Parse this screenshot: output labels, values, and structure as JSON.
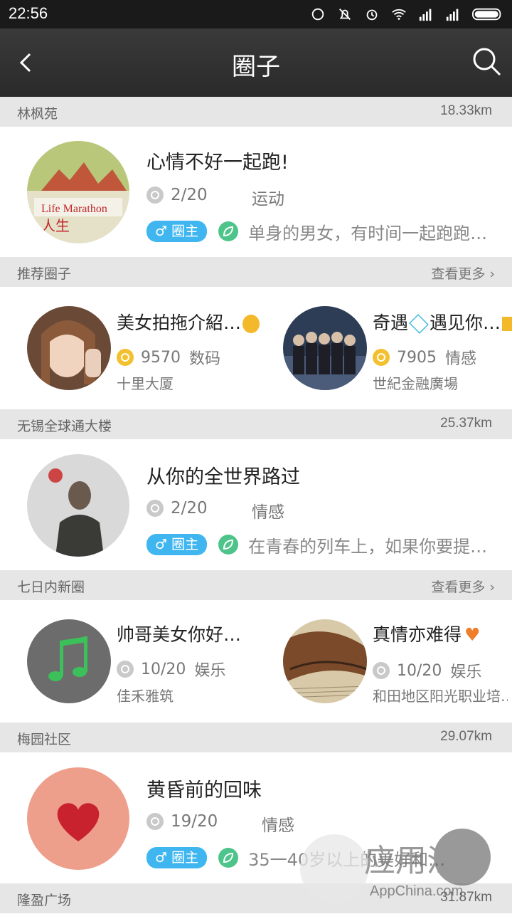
{
  "status_bar": {
    "time": "22:56"
  },
  "app_bar": {
    "title": "圈子"
  },
  "sections": [
    {
      "name": "林枫苑",
      "distance": "18.33km",
      "circle": {
        "title": "心情不好一起跑!",
        "members": "2/20",
        "category": "运动",
        "badge": "圈主",
        "description": "单身的男女，有时间一起跑跑…"
      }
    },
    {
      "name": "无锡全球通大楼",
      "distance": "25.37km",
      "circle": {
        "title": "从你的全世界路过",
        "members": "2/20",
        "category": "情感",
        "badge": "圈主",
        "description": "在青春的列车上，如果你要提…"
      }
    },
    {
      "name": "梅园社区",
      "distance": "29.07km",
      "circle": {
        "title": "黄昏前的回味",
        "members": "19/20",
        "category": "情感",
        "badge": "圈主",
        "description": "35一40岁以上的美好和…"
      }
    },
    {
      "name": "隆盈广场",
      "distance": "31.87km"
    }
  ],
  "recommended": {
    "label": "推荐圈子",
    "more": "查看更多",
    "items": [
      {
        "title": "美女拍拖介紹…",
        "count": "9570",
        "category": "数码",
        "place": "十里大厦"
      },
      {
        "title": "奇遇",
        "title2": "遇见你…",
        "count": "7905",
        "category": "情感",
        "place": "世紀金融廣場"
      }
    ]
  },
  "new_circles": {
    "label": "七日内新圈",
    "more": "查看更多",
    "items": [
      {
        "title": "帅哥美女你好…",
        "members": "10/20",
        "category": "娱乐",
        "place": "佳禾雅筑"
      },
      {
        "title": "真情亦难得",
        "members": "10/20",
        "category": "娱乐",
        "place": "和田地区阳光职业培…"
      }
    ]
  },
  "watermark": {
    "text": "AppChina.com",
    "brand": "应用汇"
  }
}
